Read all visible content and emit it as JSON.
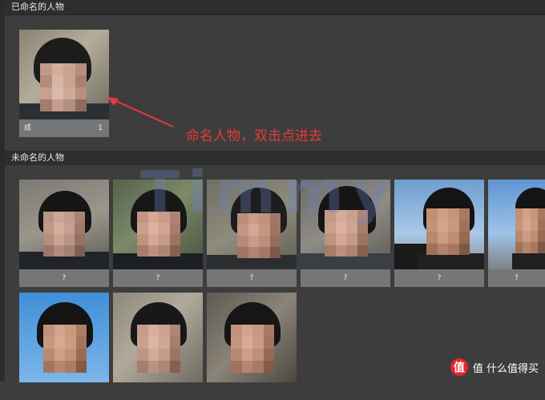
{
  "sections": {
    "named_title": "已命名的人物",
    "unnamed_title": "未命名的人物"
  },
  "named_people": [
    {
      "name": "成",
      "count": "1"
    }
  ],
  "unnamed_people": [
    {
      "label": "?"
    },
    {
      "label": "?"
    },
    {
      "label": "?"
    },
    {
      "label": "?"
    },
    {
      "label": "?"
    },
    {
      "label": "?"
    },
    {
      "label": ""
    },
    {
      "label": ""
    },
    {
      "label": ""
    }
  ],
  "annotation": {
    "text": "命名人物，双击点进去",
    "color": "#e8383b"
  },
  "watermark": {
    "text": "Timmy"
  },
  "brand": {
    "text": "值 什么值得买",
    "logo": "值"
  },
  "icons": {
    "arrow": "red-arrow-icon"
  }
}
